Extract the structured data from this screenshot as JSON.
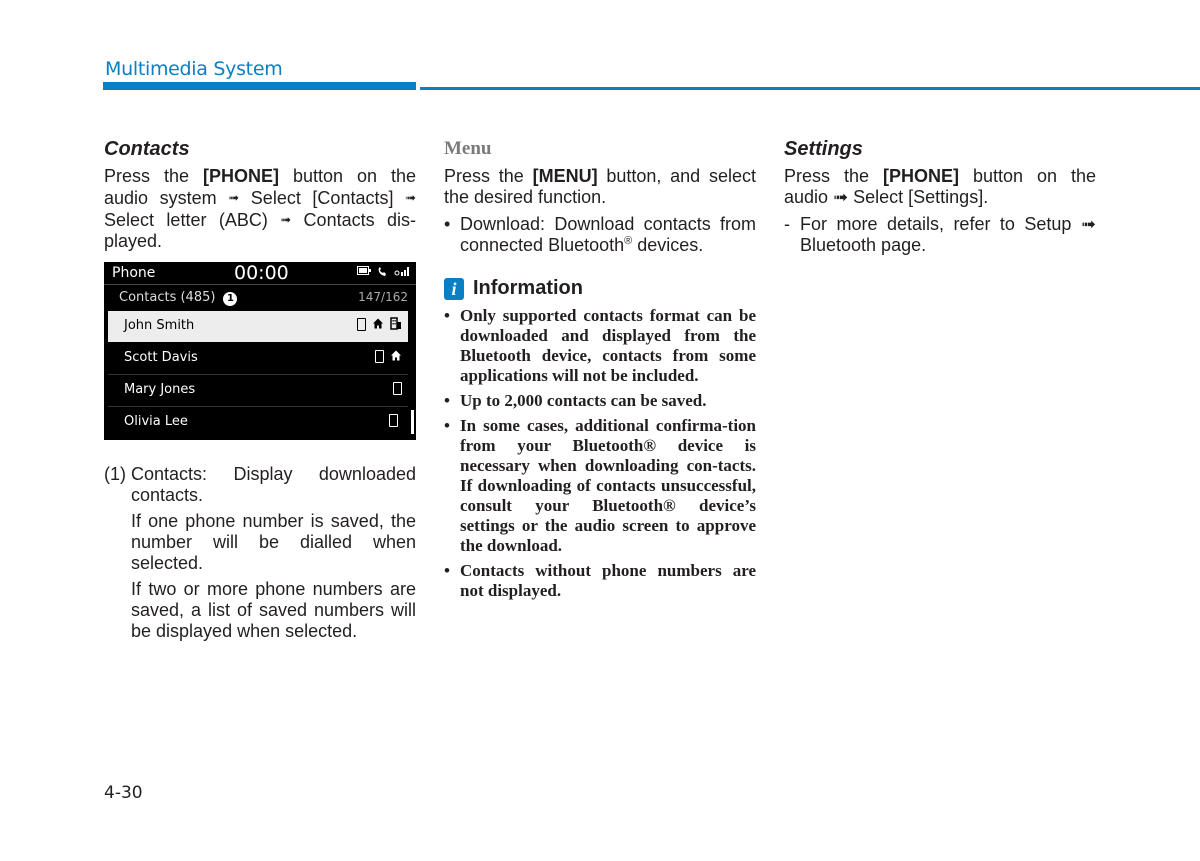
{
  "header": {
    "title": "Multimedia System",
    "accent_color": "#0a7fc4"
  },
  "contacts_section": {
    "heading": "Contacts",
    "intro_parts": [
      "Press the ",
      "[PHONE]",
      " button on the audio system ",
      " Select [Contacts] ",
      " Select letter (ABC) ",
      " Contacts dis-played."
    ],
    "arrow": "➟"
  },
  "screen": {
    "title": "Phone",
    "clock": "00:00",
    "status_icons": [
      "battery-icon",
      "phone-handset-icon",
      "signal-icon"
    ],
    "list_label": "Contacts (485)",
    "callout_number": "1",
    "count": "147/162",
    "contacts": [
      {
        "name": "John Smith",
        "selected": true,
        "icons": [
          "mobile-icon",
          "home-icon",
          "office-icon"
        ]
      },
      {
        "name": "Scott Davis",
        "selected": false,
        "icons": [
          "mobile-icon",
          "home-icon"
        ]
      },
      {
        "name": "Mary Jones",
        "selected": false,
        "icons": [
          "mobile-icon"
        ]
      },
      {
        "name": "Olivia Lee",
        "selected": false,
        "icons": [
          "mobile-icon"
        ]
      }
    ]
  },
  "caption": {
    "number": "(1)",
    "paragraphs": [
      "Contacts: Display downloaded contacts.",
      "If one phone number is saved, the number will be dialled when selected.",
      "If two or more phone numbers are saved, a list of saved numbers will be displayed when selected."
    ]
  },
  "menu_section": {
    "heading": "Menu",
    "intro_pre": "Press the ",
    "intro_bold": "[MENU]",
    "intro_post": " button, and select the desired function.",
    "bullets": [
      {
        "pre": "Download: Download contacts from connected Bluetooth",
        "sup": "®",
        "post": " devices."
      }
    ]
  },
  "information": {
    "icon": "i",
    "title": "Information",
    "bullets": [
      "Only supported contacts format can be downloaded and displayed from the Bluetooth device, contacts from some applications will not be included.",
      "Up to 2,000 contacts can be saved.",
      "In some cases, additional confirma-tion from your Bluetooth® device is necessary when downloading con-tacts. If downloading of contacts unsuccessful, consult your Bluetooth® device’s settings or the audio screen to approve the download.",
      "Contacts without phone numbers are not displayed."
    ]
  },
  "settings_section": {
    "heading": "Settings",
    "intro_pre": "Press the ",
    "intro_bold": "[PHONE]",
    "intro_post": " button on the audio ➟ Select [Settings].",
    "dash_items": [
      "For more details, refer to Setup ➟ Bluetooth page."
    ]
  },
  "page_number": "4-30"
}
